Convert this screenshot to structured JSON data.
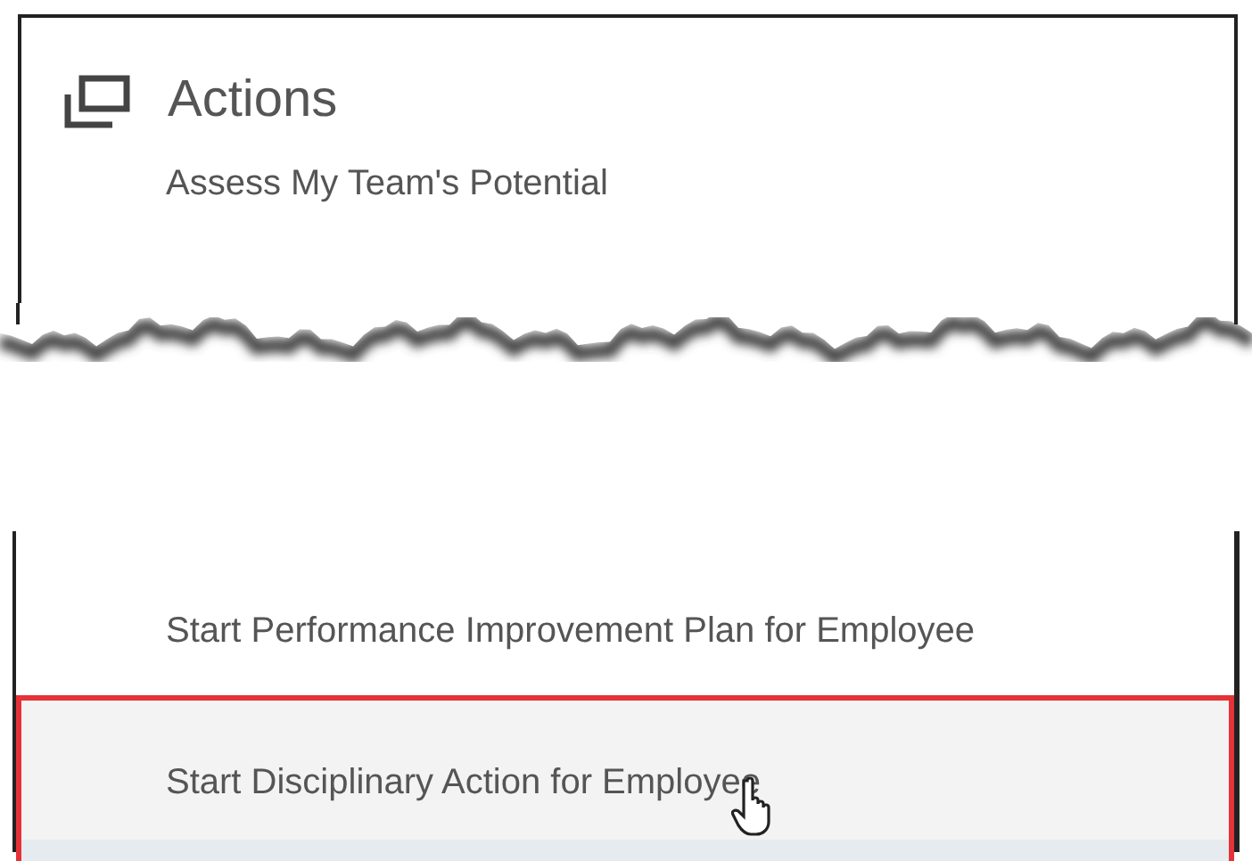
{
  "title": "Actions",
  "groups": [
    {
      "items": [
        {
          "label": "Assess My Team's Potential",
          "selected": false
        }
      ]
    },
    {
      "items": [
        {
          "label": "Start Performance Improvement Plan for Employee",
          "selected": false
        },
        {
          "label": "Start Disciplinary Action for Employee",
          "selected": true
        }
      ]
    }
  ]
}
